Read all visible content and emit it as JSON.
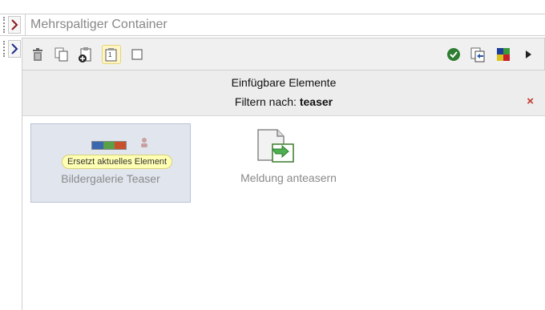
{
  "header": {
    "title": "Mehrspaltiger Container"
  },
  "panel": {
    "title": "Einfügbare Elemente",
    "filter_label": "Filtern nach:",
    "filter_value": "teaser",
    "close": "×"
  },
  "elements": [
    {
      "label": "Bildergalerie Teaser",
      "badge": "Ersetzt aktuelles Element",
      "selected": true
    },
    {
      "label": "Meldung anteasern",
      "selected": false
    }
  ],
  "toolbar": {
    "left_icons": [
      "trash-icon",
      "copy-icon",
      "add-clipboard-icon",
      "paste-icon",
      "checkbox-icon"
    ],
    "right_icons": [
      "check-icon",
      "replace-icon",
      "color-grid-icon",
      "play-icon"
    ]
  },
  "colors": {
    "chevron_header": "#8b1a1a",
    "chevron_second": "#1e2e8a",
    "check": "#2e7d32",
    "close": "#c0392b",
    "colorbar": [
      "#3a68b0",
      "#5aa046",
      "#c8502a"
    ]
  }
}
